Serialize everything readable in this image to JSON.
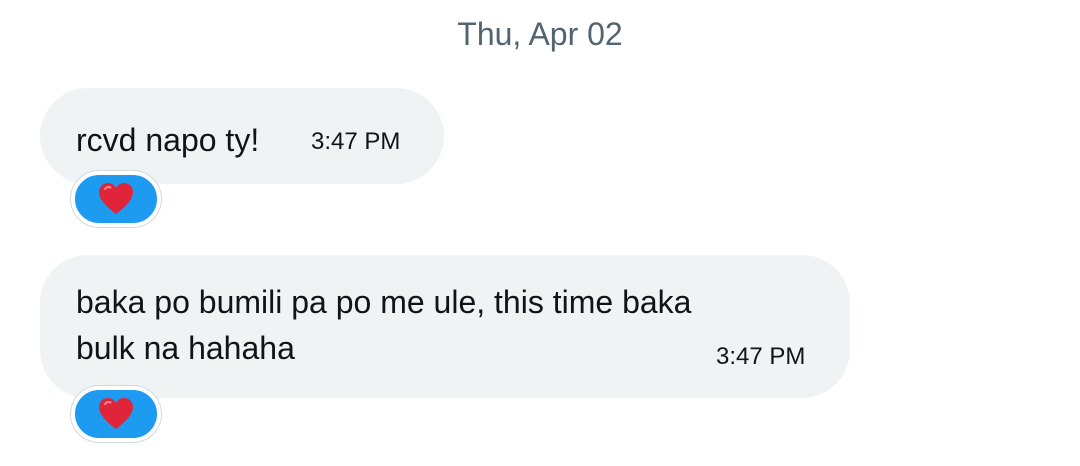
{
  "conversation": {
    "date_separator": "Thu, Apr 02",
    "messages": [
      {
        "text": "rcvd napo ty!",
        "time": "3:47 PM",
        "reaction": "heart-icon"
      },
      {
        "text": "baka po bumili pa po me ule, this time baka\nbulk na hahaha",
        "time": "3:47 PM",
        "reaction": "heart-icon"
      }
    ]
  },
  "colors": {
    "bubble_background": "#eff3f4",
    "reaction_background": "#1d9bf0",
    "heart": "#e0243a",
    "date_text": "#536471"
  }
}
